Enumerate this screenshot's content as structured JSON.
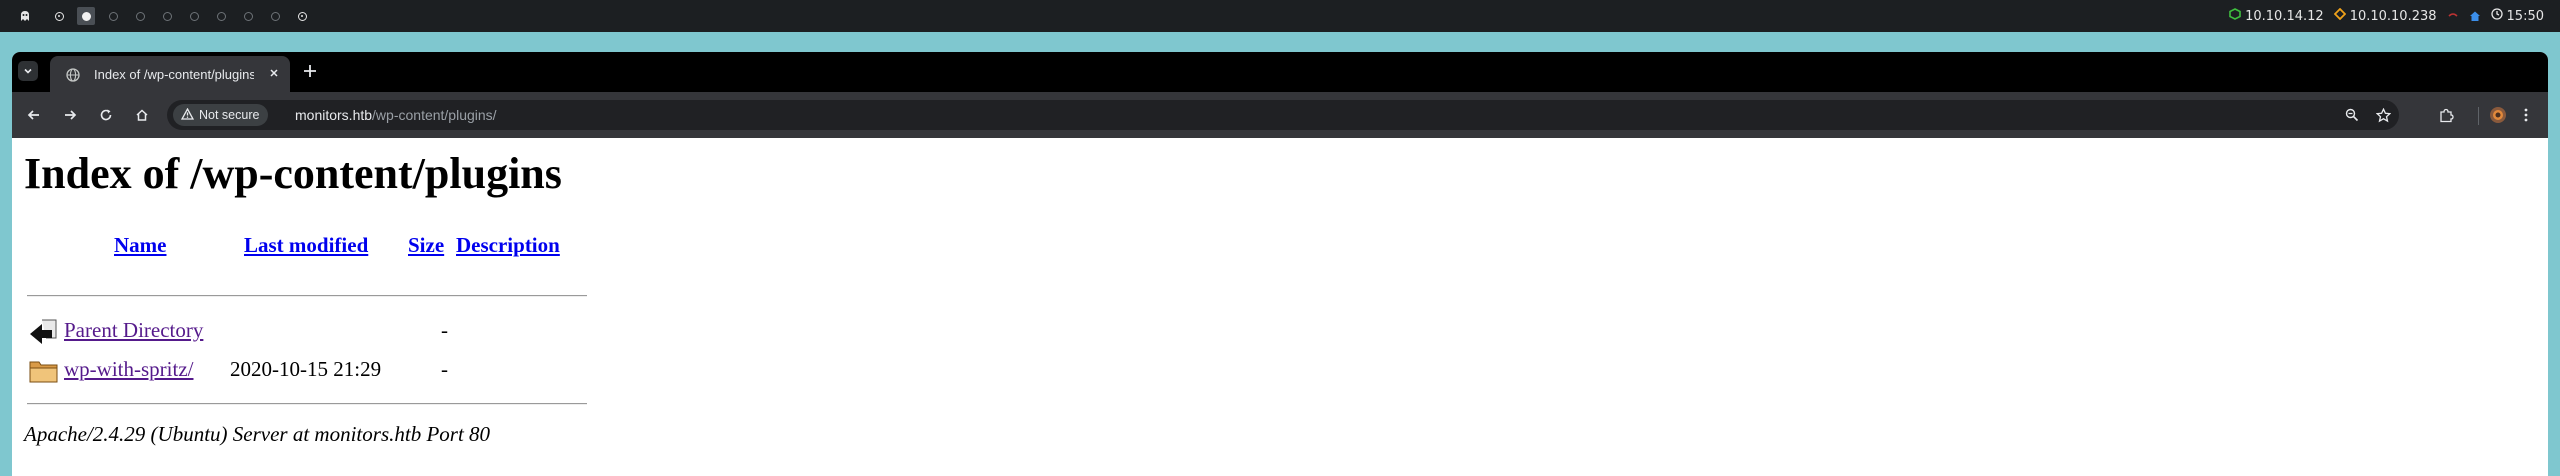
{
  "system_bar": {
    "clock": "15:50",
    "ips": [
      {
        "label": "10.10.14.12",
        "color": "#3fbf3f",
        "icon": "network-icon"
      },
      {
        "label": "10.10.10.238",
        "color": "#f0a21a",
        "icon": "target-icon"
      }
    ]
  },
  "browser": {
    "tab_title": "Index of /wp-content/plugins/",
    "security_chip": "Not secure",
    "url_host": "monitors.htb",
    "url_path": "/wp-content/plugins/"
  },
  "page": {
    "heading": "Index of /wp-content/plugins",
    "columns": {
      "name": "Name",
      "last_modified": "Last modified",
      "size": "Size",
      "description": "Description"
    },
    "rows": [
      {
        "name": "Parent Directory",
        "modified": "",
        "size": "-",
        "icon": "back-arrow-icon"
      },
      {
        "name": "wp-with-spritz/",
        "modified": "2020-10-15 21:29",
        "size": "-",
        "icon": "folder-icon"
      }
    ],
    "address": "Apache/2.4.29 (Ubuntu) Server at monitors.htb Port 80"
  }
}
